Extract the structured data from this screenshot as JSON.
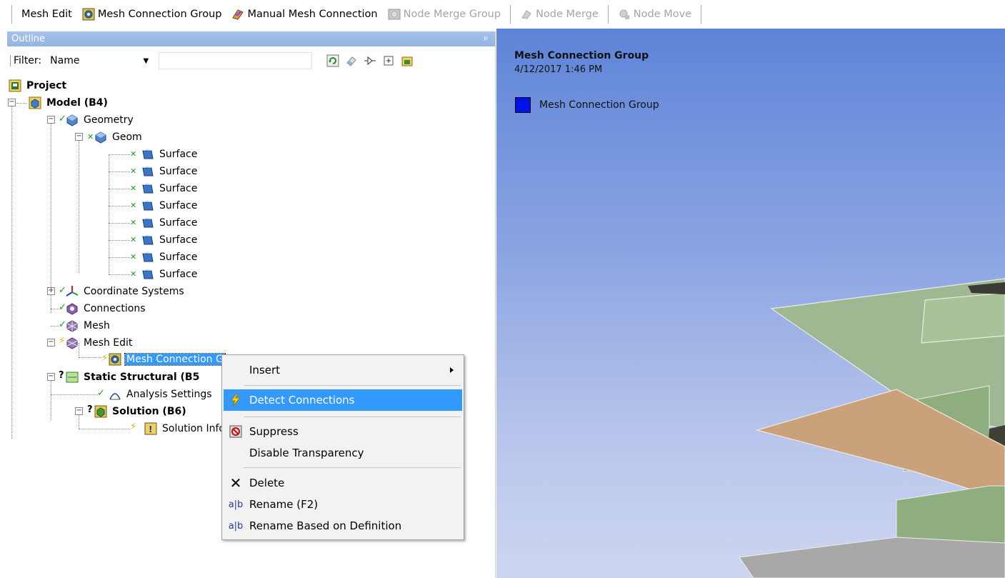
{
  "toolbar": {
    "items": [
      {
        "label": "Mesh Edit",
        "disabled": false,
        "icon": "none"
      },
      {
        "label": "Mesh Connection Group",
        "disabled": false,
        "icon": "mesh-connection-group-icon"
      },
      {
        "label": "Manual Mesh Connection",
        "disabled": false,
        "icon": "manual-mesh-connection-icon"
      },
      {
        "label": "Node Merge Group",
        "disabled": true,
        "icon": "node-merge-group-icon"
      },
      {
        "label": "Node Merge",
        "disabled": true,
        "icon": "node-merge-icon"
      },
      {
        "label": "Node Move",
        "disabled": true,
        "icon": "node-move-icon"
      }
    ]
  },
  "outline": {
    "title": "Outline",
    "filter_label": "Filter:",
    "filter_value": "Name",
    "filter_text": ""
  },
  "tree": {
    "project": "Project",
    "model": "Model (B4)",
    "geometry": "Geometry",
    "geom": "Geom",
    "surfaces": [
      "Surface",
      "Surface",
      "Surface",
      "Surface",
      "Surface",
      "Surface",
      "Surface",
      "Surface"
    ],
    "coordinate_systems": "Coordinate Systems",
    "connections": "Connections",
    "mesh": "Mesh",
    "mesh_edit": "Mesh Edit",
    "mesh_connection_group": "Mesh Connection G",
    "static_structural": "Static Structural (B5",
    "analysis_settings": "Analysis Settings",
    "solution": "Solution (B6)",
    "solution_info": "Solution Infor"
  },
  "context_menu": {
    "insert": "Insert",
    "detect_connections": "Detect Connections",
    "suppress": "Suppress",
    "disable_transparency": "Disable Transparency",
    "delete": "Delete",
    "rename": "Rename (F2)",
    "rename_based": "Rename Based on Definition"
  },
  "viewport": {
    "title": "Mesh Connection Group",
    "date": "4/12/2017 1:46 PM",
    "legend_label": "Mesh Connection Group",
    "legend_color": "#0012e8"
  },
  "colors": {
    "selection": "#3399ff",
    "outline_title": "#a4c2ea",
    "surface_green": "#9fb892",
    "surface_tan": "#c9a27c"
  }
}
